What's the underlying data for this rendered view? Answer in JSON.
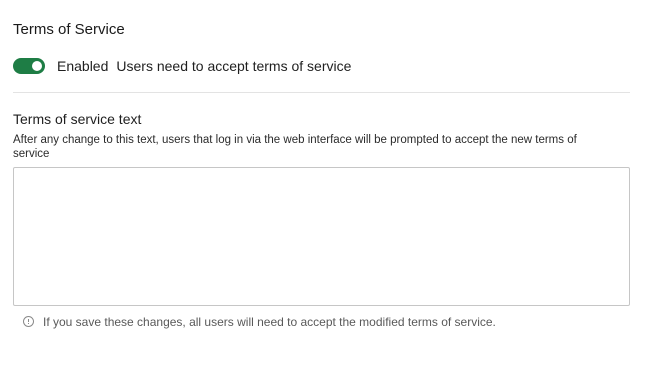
{
  "section": {
    "title": "Terms of Service"
  },
  "toggle": {
    "enabled": true,
    "state_label": "Enabled",
    "description": "Users need to accept terms of service",
    "color": "#1e7d45"
  },
  "field": {
    "label": "Terms of service text",
    "help": "After any change to this text, users that log in via the web interface will be prompted to accept the new terms of service",
    "value": "",
    "placeholder": ""
  },
  "warning": {
    "icon": "info-icon",
    "text": "If you save these changes, all users will need to accept the modified terms of service."
  }
}
